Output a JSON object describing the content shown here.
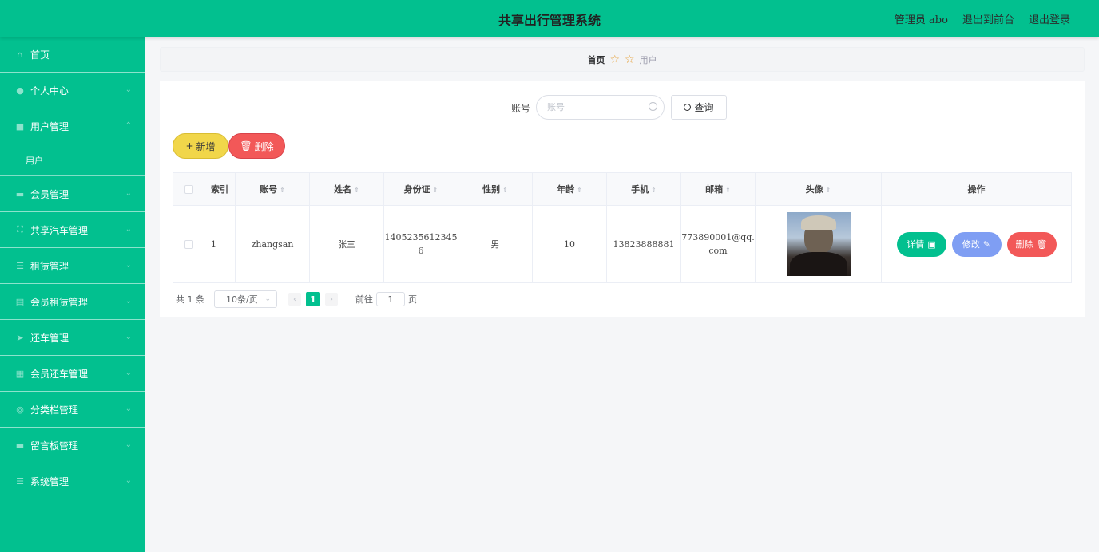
{
  "header": {
    "title": "共享出行管理系统",
    "admin": "管理员 abo",
    "to_front": "退出到前台",
    "logout": "退出登录"
  },
  "sidebar": {
    "items": [
      {
        "label": "首页",
        "icon": "home-icon"
      },
      {
        "label": "个人中心",
        "icon": "user-icon"
      },
      {
        "label": "用户管理",
        "icon": "users-icon"
      },
      {
        "label": "用户",
        "icon": ""
      },
      {
        "label": "会员管理",
        "icon": "member-icon"
      },
      {
        "label": "共享汽车管理",
        "icon": "car-icon"
      },
      {
        "label": "租赁管理",
        "icon": "list-icon"
      },
      {
        "label": "会员租赁管理",
        "icon": "doc-icon"
      },
      {
        "label": "还车管理",
        "icon": "send-icon"
      },
      {
        "label": "会员还车管理",
        "icon": "grid-icon"
      },
      {
        "label": "分类栏管理",
        "icon": "circle-icon"
      },
      {
        "label": "留言板管理",
        "icon": "chat-icon"
      },
      {
        "label": "系统管理",
        "icon": "menu-icon"
      }
    ]
  },
  "breadcrumb": {
    "home": "首页",
    "current": "用户"
  },
  "search": {
    "label": "账号",
    "placeholder": "账号",
    "button": "查询"
  },
  "actions": {
    "add": "新增",
    "delete": "删除"
  },
  "table": {
    "headers": [
      "索引",
      "账号",
      "姓名",
      "身份证",
      "性别",
      "年龄",
      "手机",
      "邮箱",
      "头像",
      "操作"
    ],
    "rows": [
      {
        "index": "1",
        "account": "zhangsan",
        "name": "张三",
        "id_card_line1": "1405235612345",
        "id_card_line2": "6",
        "gender": "男",
        "age": "10",
        "phone": "13823888881",
        "email_line1": "773890001@qq.",
        "email_line2": "com"
      }
    ],
    "row_actions": {
      "detail": "详情",
      "edit": "修改",
      "delete": "删除"
    }
  },
  "pagination": {
    "total": "共 1 条",
    "page_size": "10条/页",
    "current_page": "1",
    "goto_label": "前往",
    "goto_value": "1",
    "page_suffix": "页"
  },
  "colors": {
    "primary": "#02c08f",
    "add": "#f1d64a",
    "danger": "#f25858",
    "edit": "#7f9ef3"
  }
}
